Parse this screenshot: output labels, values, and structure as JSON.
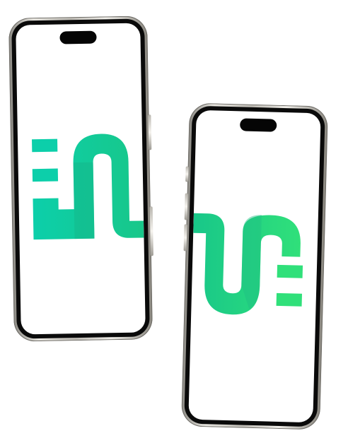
{
  "scene": {
    "title": "",
    "brand": {
      "accent_dark": "#0ccfaa",
      "accent_mid": "#18c789",
      "accent_light": "#30e07a"
    },
    "phones": [
      {
        "label": "left-phone",
        "icon": "brand-logo"
      },
      {
        "label": "right-phone",
        "icon": "brand-logo"
      }
    ]
  }
}
